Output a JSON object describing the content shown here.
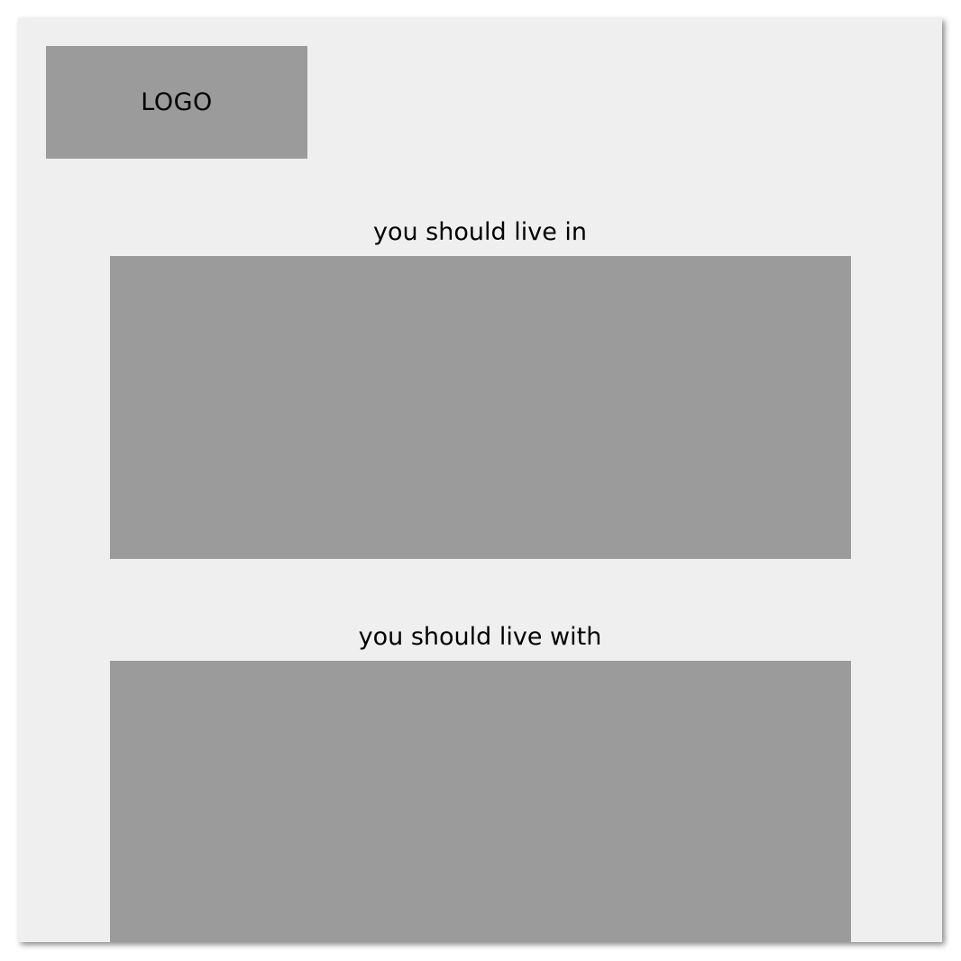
{
  "logo": {
    "label": "LOGO"
  },
  "sections": [
    {
      "heading": "you should live in"
    },
    {
      "heading": "you should live with"
    }
  ],
  "colors": {
    "background": "#efefef",
    "placeholder": "#9b9b9b",
    "text": "#000000"
  }
}
